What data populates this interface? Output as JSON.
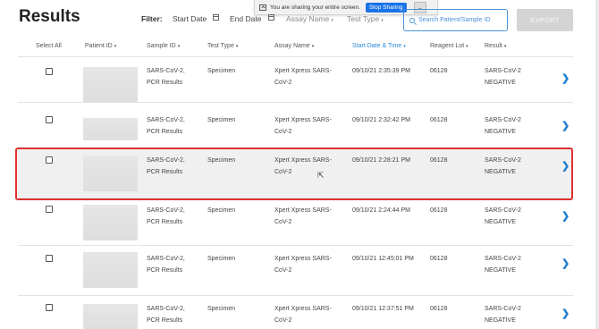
{
  "share_bar": {
    "message": "You are sharing your entire screen.",
    "stop_label": "Stop Sharing",
    "hide_label": "_"
  },
  "header": {
    "title": "Results",
    "filter_label": "Filter:",
    "start_date": "Start Date",
    "end_date": "End Date",
    "assay_name": "Assay Name",
    "test_type": "Test Type",
    "search_placeholder": "Search Patient/Sample ID",
    "export_label": "EXPORT"
  },
  "columns": {
    "select_all": "Select All",
    "patient_id": "Patient ID",
    "sample_id": "Sample ID",
    "test_type": "Test Type",
    "assay_name": "Assay Name",
    "start_date": "Start Date & Time",
    "reagent_lot": "Reagent Lot",
    "result": "Result"
  },
  "rows": [
    {
      "sample_1": "SARS-CoV-2,",
      "sample_2": "PCR Results",
      "test_type": "Specimen",
      "assay_1": "Xpert Xpress SARS-",
      "assay_2": "CoV-2",
      "date": "09/10/21 2:35:39 PM",
      "lot": "06128",
      "result_1": "SARS-CoV-2",
      "result_2": "NEGATIVE"
    },
    {
      "sample_1": "SARS-CoV-2,",
      "sample_2": "PCR Results",
      "test_type": "Specimen",
      "assay_1": "Xpert Xpress SARS-",
      "assay_2": "CoV-2",
      "date": "09/10/21 2:32:42 PM",
      "lot": "06128",
      "result_1": "SARS-CoV-2",
      "result_2": "NEGATIVE"
    },
    {
      "sample_1": "SARS-CoV-2,",
      "sample_2": "PCR Results",
      "test_type": "Specimen",
      "assay_1": "Xpert Xpress SARS-",
      "assay_2": "CoV-2",
      "date": "09/10/21 2:28:21 PM",
      "lot": "06128",
      "result_1": "SARS-CoV-2",
      "result_2": "NEGATIVE"
    },
    {
      "sample_1": "SARS-CoV-2,",
      "sample_2": "PCR Results",
      "test_type": "Specimen",
      "assay_1": "Xpert Xpress SARS-",
      "assay_2": "CoV-2",
      "date": "09/10/21 2:24:44 PM",
      "lot": "06128",
      "result_1": "SARS-CoV-2",
      "result_2": "NEGATIVE"
    },
    {
      "sample_1": "SARS-CoV-2,",
      "sample_2": "PCR Results",
      "test_type": "Specimen",
      "assay_1": "Xpert Xpress SARS-",
      "assay_2": "CoV-2",
      "date": "09/10/21 12:45:01 PM",
      "lot": "06128",
      "result_1": "SARS-CoV-2",
      "result_2": "NEGATIVE"
    },
    {
      "sample_1": "SARS-CoV-2,",
      "sample_2": "PCR Results",
      "test_type": "Specimen",
      "assay_1": "Xpert Xpress SARS-",
      "assay_2": "CoV-2",
      "date": "09/10/21 12:37:51 PM",
      "lot": "06128",
      "result_1": "SARS-CoV-2",
      "result_2": "NEGATIVE"
    }
  ],
  "icons": {
    "chevron": "chevron-right-icon",
    "calendar": "calendar-icon",
    "search": "search-icon"
  },
  "colors": {
    "accent": "#2b8ad8",
    "highlight": "#e03030",
    "export_disabled": "#d4d4d4"
  }
}
